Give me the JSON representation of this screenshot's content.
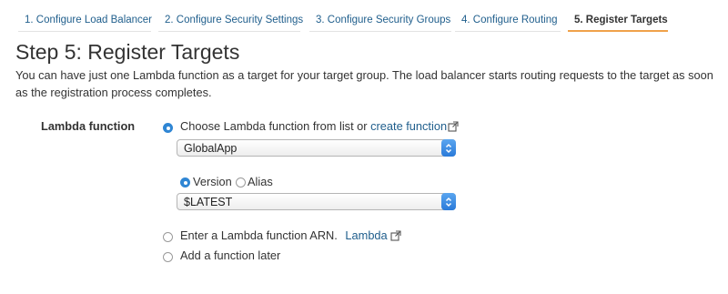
{
  "tabs": [
    {
      "label": "1. Configure Load Balancer"
    },
    {
      "label": "2. Configure Security Settings"
    },
    {
      "label": "3. Configure Security Groups"
    },
    {
      "label": "4. Configure Routing"
    },
    {
      "label": "5. Register Targets",
      "active": true
    }
  ],
  "page": {
    "title": "Step 5: Register Targets",
    "description": "You can have just one Lambda function as a target for your target group. The load balancer starts routing requests to the target as soon as the registration process completes."
  },
  "form": {
    "field_label": "Lambda function",
    "option_list": {
      "label": "Choose Lambda function from list or ",
      "link": "create function",
      "selected": true
    },
    "function_select": {
      "value": "GlobalApp"
    },
    "version_radio": {
      "label": "Version",
      "selected": true
    },
    "alias_radio": {
      "label": "Alias",
      "selected": false
    },
    "version_select": {
      "value": "$LATEST"
    },
    "option_arn": {
      "label": "Enter a Lambda function ARN.",
      "link": "Lambda",
      "selected": false
    },
    "option_later": {
      "label": "Add a function later",
      "selected": false
    }
  },
  "icons": {
    "external_link": "external-link-icon",
    "select_arrows": "up-down-chevron-icon"
  },
  "colors": {
    "link": "#1f5e8c",
    "active_tab_underline": "#f0a24a",
    "radio_selected": "#2f86d4",
    "select_arrow": "#2a7ad9"
  }
}
